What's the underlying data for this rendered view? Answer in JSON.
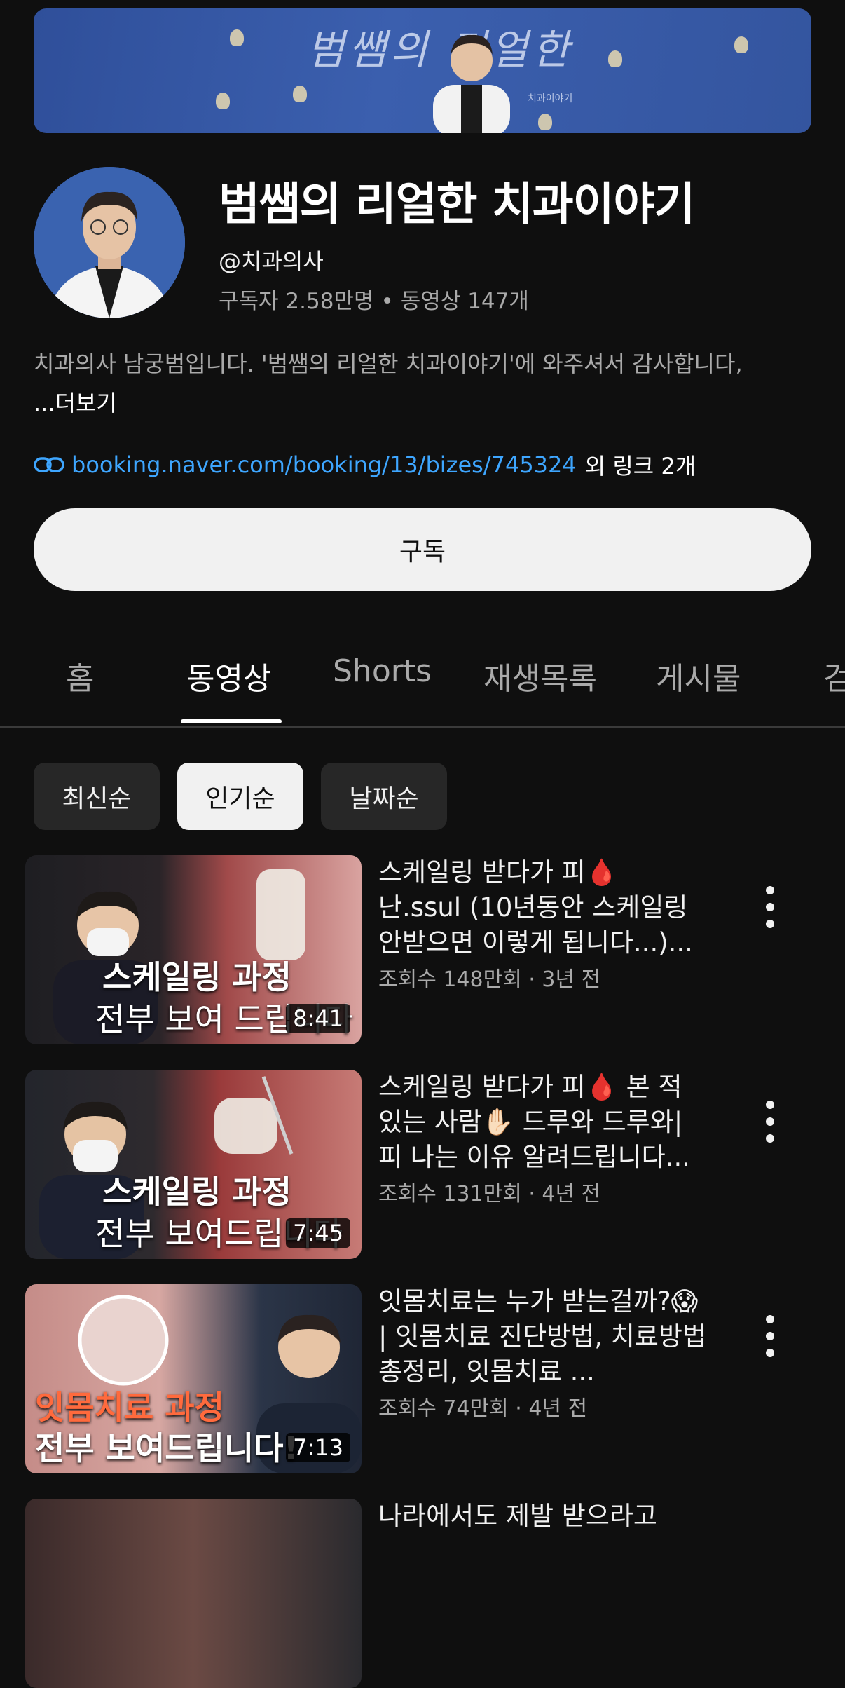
{
  "channel": {
    "name": "범쌤의 리얼한 치과이야기",
    "handle": "@치과의사",
    "subscribers": "구독자 2.58만명",
    "videos_count": "동영상 147개",
    "description": "치과의사 남궁범입니다. '범쌤의 리얼한 치과이야기'에 와주셔서 감사합니다,",
    "more_label": "...더보기",
    "link_url": "booking.naver.com/booking/13/bizes/745324",
    "link_extra": "외 링크 2개",
    "subscribe_label": "구독",
    "banner_text": "범쌤의 리얼한",
    "banner_sub": "치과이야기"
  },
  "tabs": [
    {
      "label": "홈"
    },
    {
      "label": "동영상"
    },
    {
      "label": "Shorts"
    },
    {
      "label": "재생목록"
    },
    {
      "label": "게시물"
    },
    {
      "label": "검"
    }
  ],
  "active_tab": "동영상",
  "chips": [
    {
      "label": "최신순"
    },
    {
      "label": "인기순"
    },
    {
      "label": "날짜순"
    }
  ],
  "selected_chip": "인기순",
  "videos": [
    {
      "title": "스케일링 받다가 피🩸 난.ssul (10년동안 스케일링 안받으면 이렇게 됩니다...)...",
      "meta": "조회수 148만회 · 3년 전",
      "duration": "8:41",
      "thumb_line1": "스케일링 과정",
      "thumb_line2": "전부 보여 드립니다"
    },
    {
      "title": "스케일링 받다가 피🩸 본 적 있는 사람✋🏻 드루와 드루와| 피 나는 이유 알려드립니다...",
      "meta": "조회수 131만회 · 4년 전",
      "duration": "7:45",
      "thumb_line1": "스케일링 과정",
      "thumb_line2": "전부 보여드립니다"
    },
    {
      "title": "잇몸치료는 누가 받는걸까?😱 | 잇몸치료 진단방법, 치료방법 총정리, 잇몸치료 ...",
      "meta": "조회수 74만회 · 4년 전",
      "duration": "7:13",
      "thumb_line1": "잇몸치료 과정",
      "thumb_line2": "전부 보여드립니다!"
    },
    {
      "title": "나라에서도 제발 받으라고",
      "meta": "",
      "duration": "",
      "thumb_line1": "",
      "thumb_line2": ""
    }
  ],
  "colors": {
    "background": "#0f0f0f",
    "link": "#3ea6ff",
    "chip": "#272727",
    "chip_selected": "#f1f1f1"
  }
}
